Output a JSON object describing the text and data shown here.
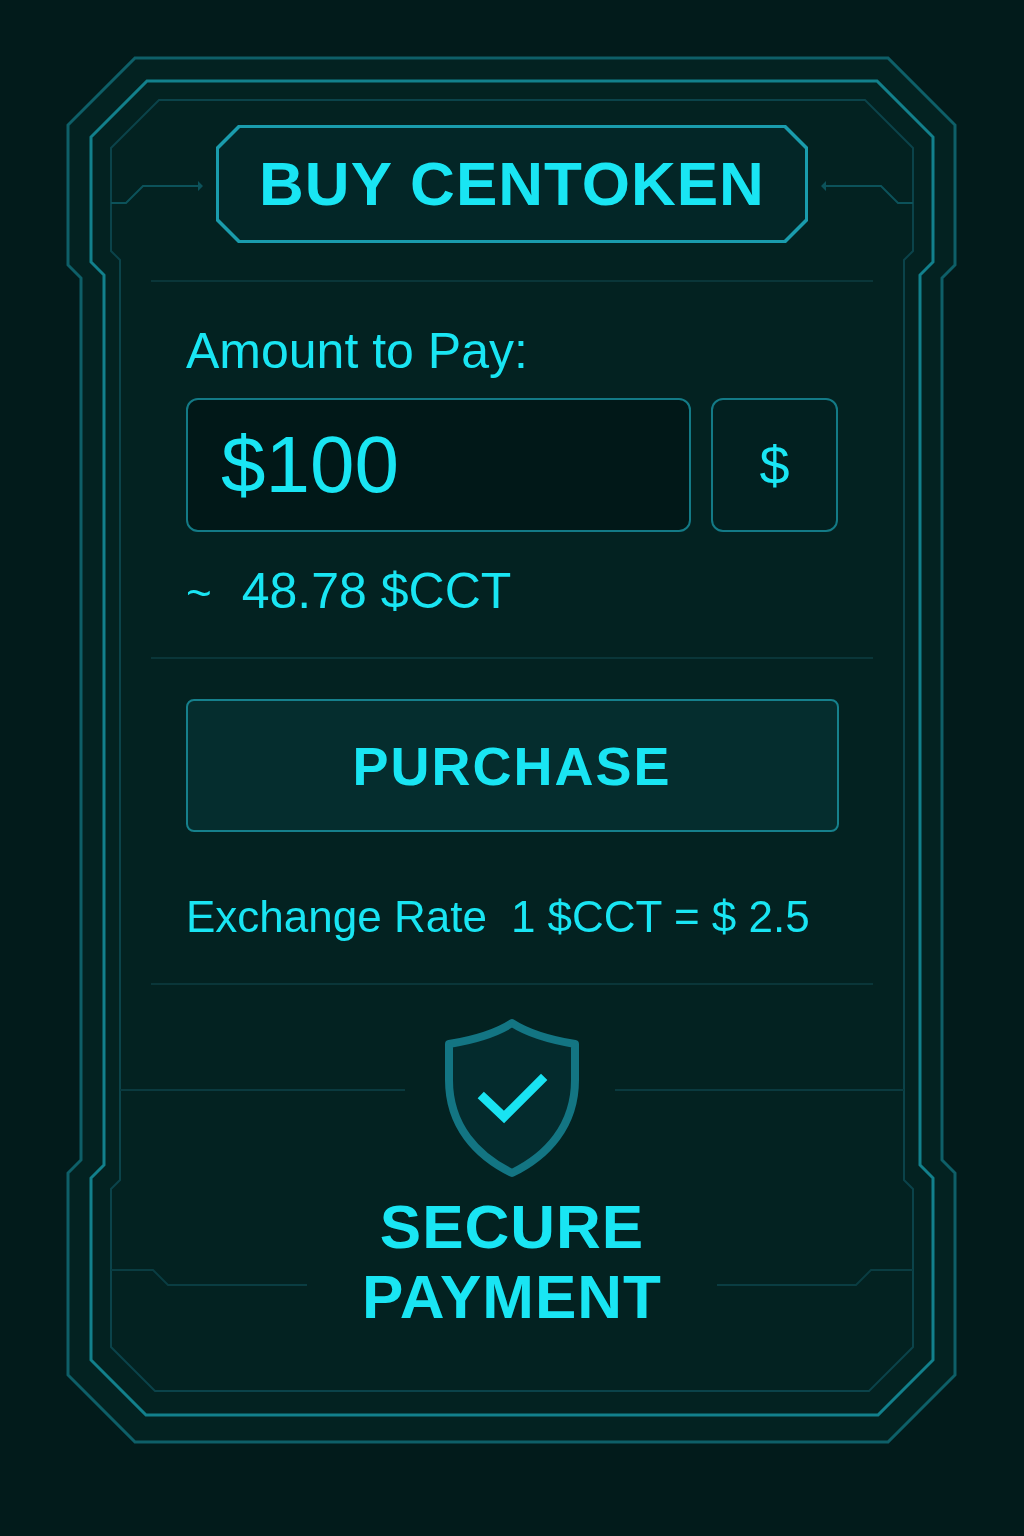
{
  "title": "BUY CENTOKEN",
  "amount": {
    "label": "Amount to Pay:",
    "value": "$100",
    "currency_button": "$",
    "estimate_prefix": "~",
    "estimate": "48.78 $CCT"
  },
  "purchase_button": "PURCHASE",
  "exchange_rate": {
    "label": "Exchange Rate",
    "value": "1 $CCT = $ 2.5"
  },
  "secure_badge": {
    "text": "SECURE PAYMENT"
  }
}
